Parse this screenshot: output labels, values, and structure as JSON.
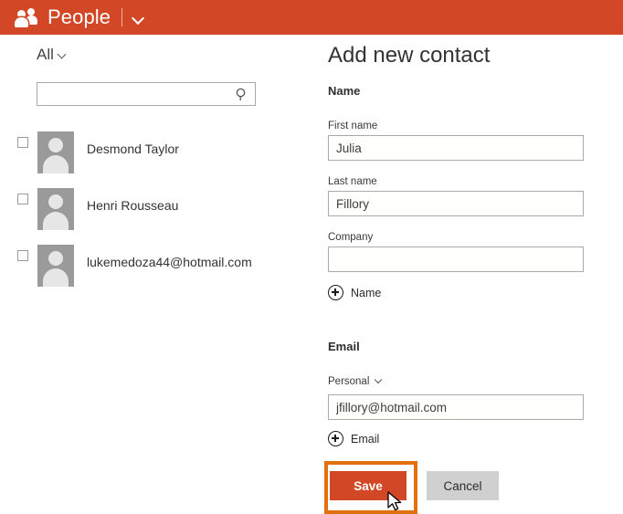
{
  "header": {
    "icon": "people-icon",
    "title": "People",
    "divider": "|",
    "chevron_icon": "chevron-down-icon",
    "accent_color": "#d24726"
  },
  "sidebar": {
    "filter": {
      "label": "All",
      "chevron_icon": "chevron-down-icon"
    },
    "search": {
      "value": "",
      "placeholder": "",
      "icon": "search-icon"
    },
    "contacts": [
      {
        "name": "Desmond Taylor",
        "checked": false,
        "avatar": "person-avatar"
      },
      {
        "name": "Henri Rousseau",
        "checked": false,
        "avatar": "person-avatar"
      },
      {
        "name": "lukemedoza44@hotmail.com",
        "checked": false,
        "avatar": "person-avatar"
      }
    ]
  },
  "form": {
    "title": "Add new contact",
    "name_section": {
      "heading": "Name",
      "first_name": {
        "label": "First name",
        "value": "Julia"
      },
      "last_name": {
        "label": "Last name",
        "value": "Fillory"
      },
      "company": {
        "label": "Company",
        "value": ""
      },
      "add_link": {
        "label": "Name",
        "icon": "plus-circle-icon"
      }
    },
    "email_section": {
      "heading": "Email",
      "type": {
        "label": "Personal",
        "chevron_icon": "chevron-down-icon"
      },
      "address": {
        "value": "jfillory@hotmail.com"
      },
      "add_link": {
        "label": "Email",
        "icon": "plus-circle-icon"
      }
    },
    "actions": {
      "save_label": "Save",
      "cancel_label": "Cancel",
      "save_color": "#d24726",
      "cancel_color": "#d0d0d0"
    }
  },
  "annotation": {
    "highlight_color": "#e2700c",
    "target": "save-button",
    "cursor": "arrow-pointer"
  }
}
